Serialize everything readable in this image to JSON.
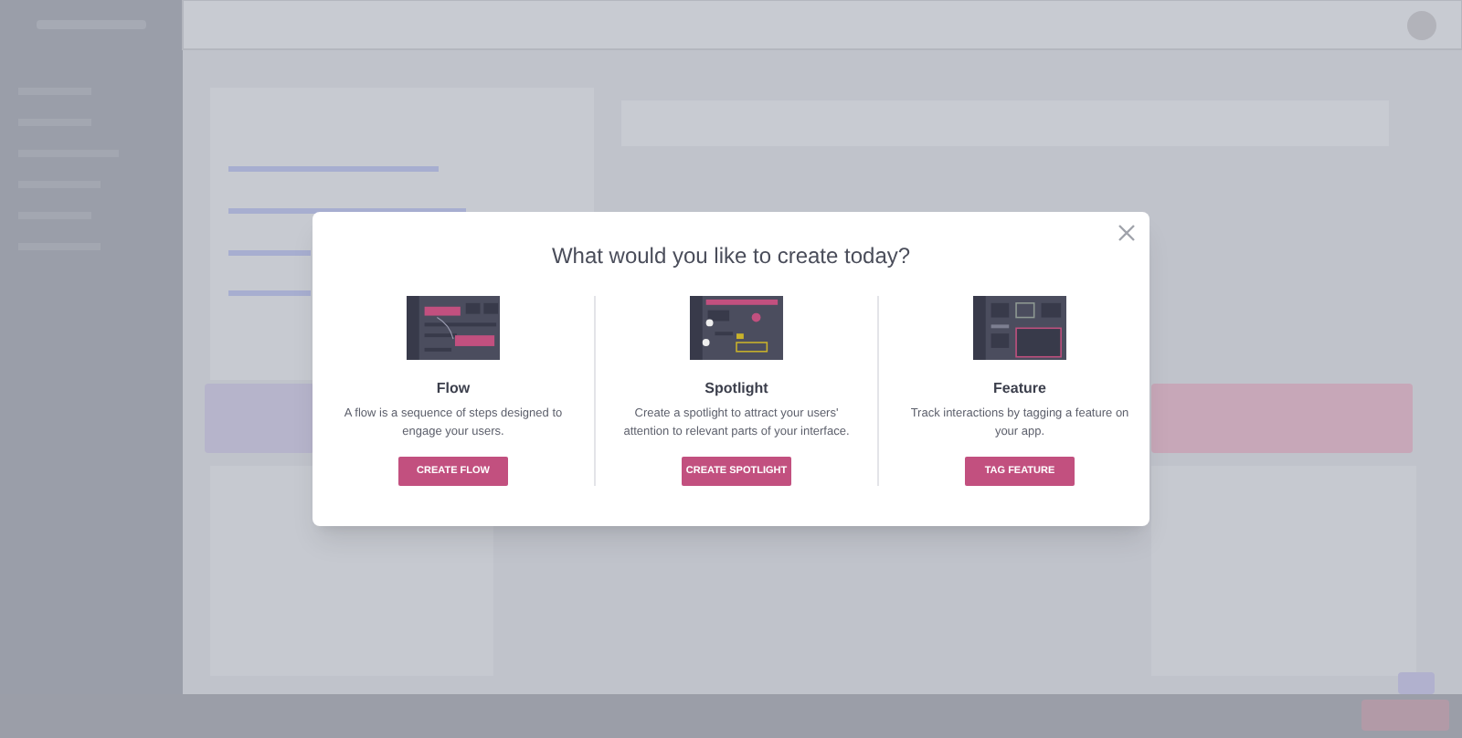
{
  "dialog": {
    "title": "What would you like to create today?",
    "options": [
      {
        "kind": "flow",
        "title": "Flow",
        "description": "A flow is a sequence of steps designed to engage your users.",
        "button": "CREATE FLOW"
      },
      {
        "kind": "spotlight",
        "title": "Spotlight",
        "description": "Create a spotlight to attract your users' attention to relevant parts of your interface.",
        "button": "CREATE SPOTLIGHT"
      },
      {
        "kind": "feature",
        "title": "Feature",
        "description": "Track interactions by tagging a feature on your app.",
        "button": "TAG FEATURE"
      }
    ]
  }
}
